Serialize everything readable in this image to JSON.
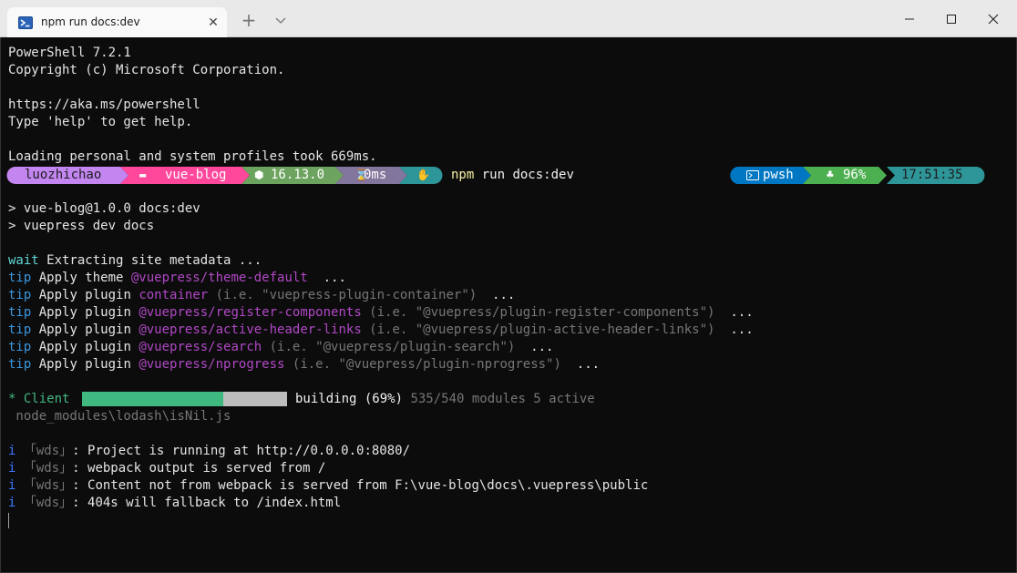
{
  "window": {
    "tab_title": "npm run docs:dev",
    "tab_icon": "powershell-icon",
    "new_tab_icon": "plus-icon",
    "dropdown_icon": "chevron-down-icon",
    "controls": [
      "minimize-icon",
      "maximize-icon",
      "close-icon"
    ]
  },
  "terminal": {
    "header": [
      "PowerShell 7.2.1",
      "Copyright (c) Microsoft Corporation.",
      "https://aka.ms/powershell",
      "Type 'help' to get help.",
      "Loading personal and system profiles took 669ms."
    ],
    "prompt": {
      "user": "luozhichao",
      "folder": "vue-blog",
      "node_version": "16.13.0",
      "exec_time": "0ms",
      "command_name": "npm",
      "command_args": " run docs:dev",
      "shell": "pwsh",
      "battery": "96%",
      "time": "17:51:35",
      "colors": {
        "user": "#c386f1",
        "folder": "#ff479c",
        "node": "#6ca35e",
        "exec": "#83769c",
        "root": "#2e9599",
        "shell": "#0077c2",
        "battery": "#4caf50",
        "time": "#2e9599"
      }
    },
    "script_lines": [
      "> vue-blog@1.0.0 docs:dev",
      "> vuepress dev docs"
    ],
    "wait_line": {
      "tag": "wait",
      "text": " Extracting site metadata ..."
    },
    "tip_lines": [
      {
        "tag": "tip",
        "action": " Apply theme ",
        "name": "@vuepress/theme-default",
        "detail": "",
        "tail": "  ..."
      },
      {
        "tag": "tip",
        "action": " Apply plugin ",
        "name": "container",
        "detail": " (i.e. \"vuepress-plugin-container\")",
        "tail": "  ..."
      },
      {
        "tag": "tip",
        "action": " Apply plugin ",
        "name": "@vuepress/register-components",
        "detail": " (i.e. \"@vuepress/plugin-register-components\")",
        "tail": "  ..."
      },
      {
        "tag": "tip",
        "action": " Apply plugin ",
        "name": "@vuepress/active-header-links",
        "detail": " (i.e. \"@vuepress/plugin-active-header-links\")",
        "tail": "  ..."
      },
      {
        "tag": "tip",
        "action": " Apply plugin ",
        "name": "@vuepress/search",
        "detail": " (i.e. \"@vuepress/plugin-search\")",
        "tail": "  ..."
      },
      {
        "tag": "tip",
        "action": " Apply plugin ",
        "name": "@vuepress/nprogress",
        "detail": " (i.e. \"@vuepress/plugin-nprogress\")",
        "tail": "  ..."
      }
    ],
    "build": {
      "label": "* Client",
      "progress_fraction": 0.69,
      "status": "building (69%)",
      "modules": " 535/540 modules 5 active",
      "current_file": " node_modules\\lodash\\isNil.js"
    },
    "wds_lines": [
      {
        "i": "i",
        "tag": " 「wds」",
        "text": ": Project is running at http://0.0.0.0:8080/"
      },
      {
        "i": "i",
        "tag": " 「wds」",
        "text": ": webpack output is served from /"
      },
      {
        "i": "i",
        "tag": " 「wds」",
        "text": ": Content not from webpack is served from F:\\vue-blog\\docs\\.vuepress\\public"
      },
      {
        "i": "i",
        "tag": " 「wds」",
        "text": ": 404s will fallback to /index.html"
      }
    ]
  }
}
